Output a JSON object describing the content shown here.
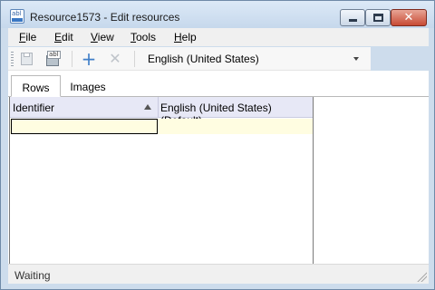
{
  "window": {
    "title": "Resource1573 - Edit resources",
    "app_icon_label": "abl"
  },
  "window_controls": {
    "close_glyph": "✕"
  },
  "menu": {
    "items": [
      {
        "accel": "F",
        "rest": "ile"
      },
      {
        "accel": "E",
        "rest": "dit"
      },
      {
        "accel": "V",
        "rest": "iew"
      },
      {
        "accel": "T",
        "rest": "ools"
      },
      {
        "accel": "H",
        "rest": "elp"
      }
    ]
  },
  "toolbar": {
    "save_icon": "save-icon",
    "saveas_label": "abl",
    "add_glyph": "+",
    "delete_glyph": "✕",
    "language": "English (United States)"
  },
  "tabs": [
    {
      "label": "Rows",
      "active": true
    },
    {
      "label": "Images",
      "active": false
    }
  ],
  "grid": {
    "columns": [
      "Identifier",
      "English (United States) (Default)"
    ],
    "sorted_column": "Identifier",
    "rows": [
      {
        "identifier": "",
        "value": ""
      }
    ]
  },
  "status": {
    "text": "Waiting"
  },
  "colors": {
    "header_bg": "#e7e8f6",
    "new_row_bg": "#fffde1",
    "chrome": "#cddcec"
  }
}
